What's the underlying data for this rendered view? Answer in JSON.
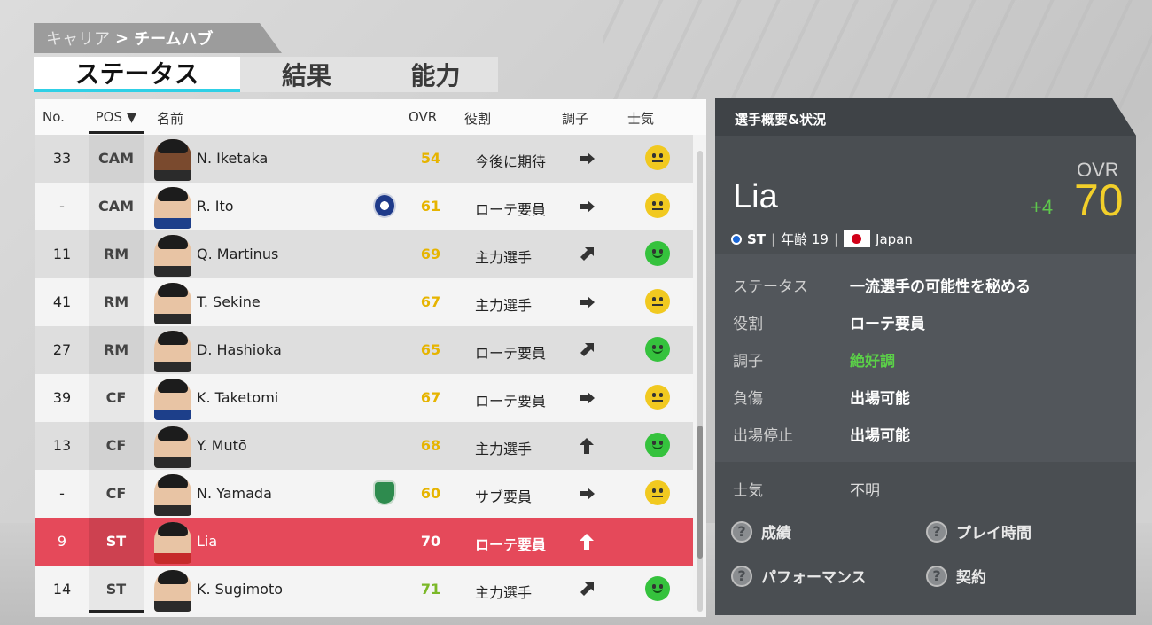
{
  "breadcrumb": {
    "parent": "キャリア",
    "separator": ">",
    "current": "チームハブ"
  },
  "tabs": [
    {
      "label": "ステータス",
      "active": true
    },
    {
      "label": "結果",
      "active": false
    },
    {
      "label": "能力",
      "active": false
    }
  ],
  "table": {
    "headers": {
      "no": "No.",
      "pos": "POS",
      "name": "名前",
      "ovr": "OVR",
      "role": "役割",
      "form": "調子",
      "morale": "士気"
    },
    "rows": [
      {
        "no": "33",
        "pos": "CAM",
        "name": "N. Iketaka",
        "ovr": "54",
        "role": "今後に期待",
        "form": "right",
        "morale": "neutral"
      },
      {
        "no": "-",
        "pos": "CAM",
        "name": "R. Ito",
        "ovr": "61",
        "role": "ローテ要員",
        "form": "right",
        "morale": "neutral",
        "club": "zelvia"
      },
      {
        "no": "11",
        "pos": "RM",
        "name": "Q. Martinus",
        "ovr": "69",
        "role": "主力選手",
        "form": "up-right",
        "morale": "happy"
      },
      {
        "no": "41",
        "pos": "RM",
        "name": "T. Sekine",
        "ovr": "67",
        "role": "主力選手",
        "form": "right",
        "morale": "neutral"
      },
      {
        "no": "27",
        "pos": "RM",
        "name": "D. Hashioka",
        "ovr": "65",
        "role": "ローテ要員",
        "form": "up-right",
        "morale": "happy"
      },
      {
        "no": "39",
        "pos": "CF",
        "name": "K. Taketomi",
        "ovr": "67",
        "role": "ローテ要員",
        "form": "right",
        "morale": "neutral"
      },
      {
        "no": "13",
        "pos": "CF",
        "name": "Y. Mutō",
        "ovr": "68",
        "role": "主力選手",
        "form": "up",
        "morale": "happy"
      },
      {
        "no": "-",
        "pos": "CF",
        "name": "N. Yamada",
        "ovr": "60",
        "role": "サブ要員",
        "form": "right",
        "morale": "neutral",
        "club": "bellmare"
      },
      {
        "no": "9",
        "pos": "ST",
        "name": "Lia",
        "ovr": "70",
        "role": "ローテ要員",
        "form": "up",
        "morale": "",
        "selected": true
      },
      {
        "no": "14",
        "pos": "ST",
        "name": "K. Sugimoto",
        "ovr": "71",
        "role": "主力選手",
        "form": "up-right",
        "morale": "happy"
      }
    ]
  },
  "panel": {
    "title": "選手概要&状況",
    "player_name": "Lia",
    "ovr_label": "OVR",
    "ovr": "70",
    "ovr_delta": "+4",
    "position": "ST",
    "age_label": "年齢 19",
    "nationality": "Japan",
    "details": [
      {
        "label": "ステータス",
        "value": "一流選手の可能性を秘める"
      },
      {
        "label": "役割",
        "value": "ローテ要員"
      },
      {
        "label": "調子",
        "value": "絶好調"
      },
      {
        "label": "負傷",
        "value": "出場可能"
      },
      {
        "label": "出場停止",
        "value": "出場可能"
      }
    ],
    "morale_label": "士気",
    "morale_value": "不明",
    "buttons": [
      "成績",
      "プレイ時間",
      "パフォーマンス",
      "契約"
    ]
  },
  "colors": {
    "accent_tab": "#2fd0e6",
    "selected_row": "#e5495a",
    "ovr_high": "#f2cf2a",
    "form_good": "#5bd048"
  }
}
